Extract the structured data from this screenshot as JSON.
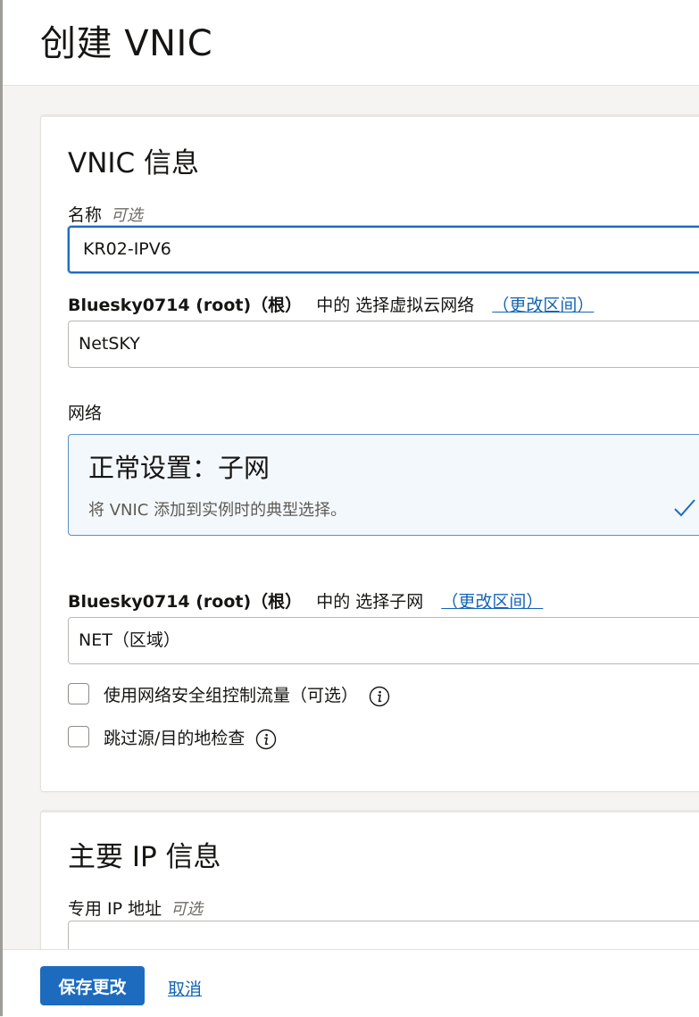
{
  "page": {
    "title": "创建 VNIC"
  },
  "vnic_section": {
    "title": "VNIC 信息",
    "name_field": {
      "label": "名称",
      "optional": "可选",
      "value": "KR02-IPV6"
    },
    "vcn": {
      "compartment": "Bluesky0714 (root)（根）",
      "in_text": "中的 选择虚拟云网络",
      "change_link": "（更改区间）",
      "value": "NetSKY"
    },
    "network": {
      "label": "网络",
      "option_title": "正常设置：子网",
      "option_desc": "将 VNIC 添加到实例时的典型选择。",
      "selected_icon": "check-icon"
    },
    "subnet": {
      "compartment": "Bluesky0714 (root)（根）",
      "in_text": "中的 选择子网",
      "change_link": "（更改区间）",
      "value": "NET（区域）"
    },
    "checkboxes": [
      {
        "label": "使用网络安全组控制流量（可选）",
        "checked": false,
        "icon": "info-icon"
      },
      {
        "label": "跳过源/目的地检查",
        "checked": false,
        "icon": "info-icon"
      }
    ]
  },
  "ip_section": {
    "title": "主要 IP 信息",
    "private_ip": {
      "label": "专用 IP 地址",
      "optional": "可选",
      "value": ""
    }
  },
  "footer": {
    "save_label": "保存更改",
    "cancel_label": "取消"
  },
  "colors": {
    "primary": "#1d6bbf",
    "link": "#1464b5",
    "background": "#f5f4f2",
    "selected_border": "#5b8fc6"
  }
}
